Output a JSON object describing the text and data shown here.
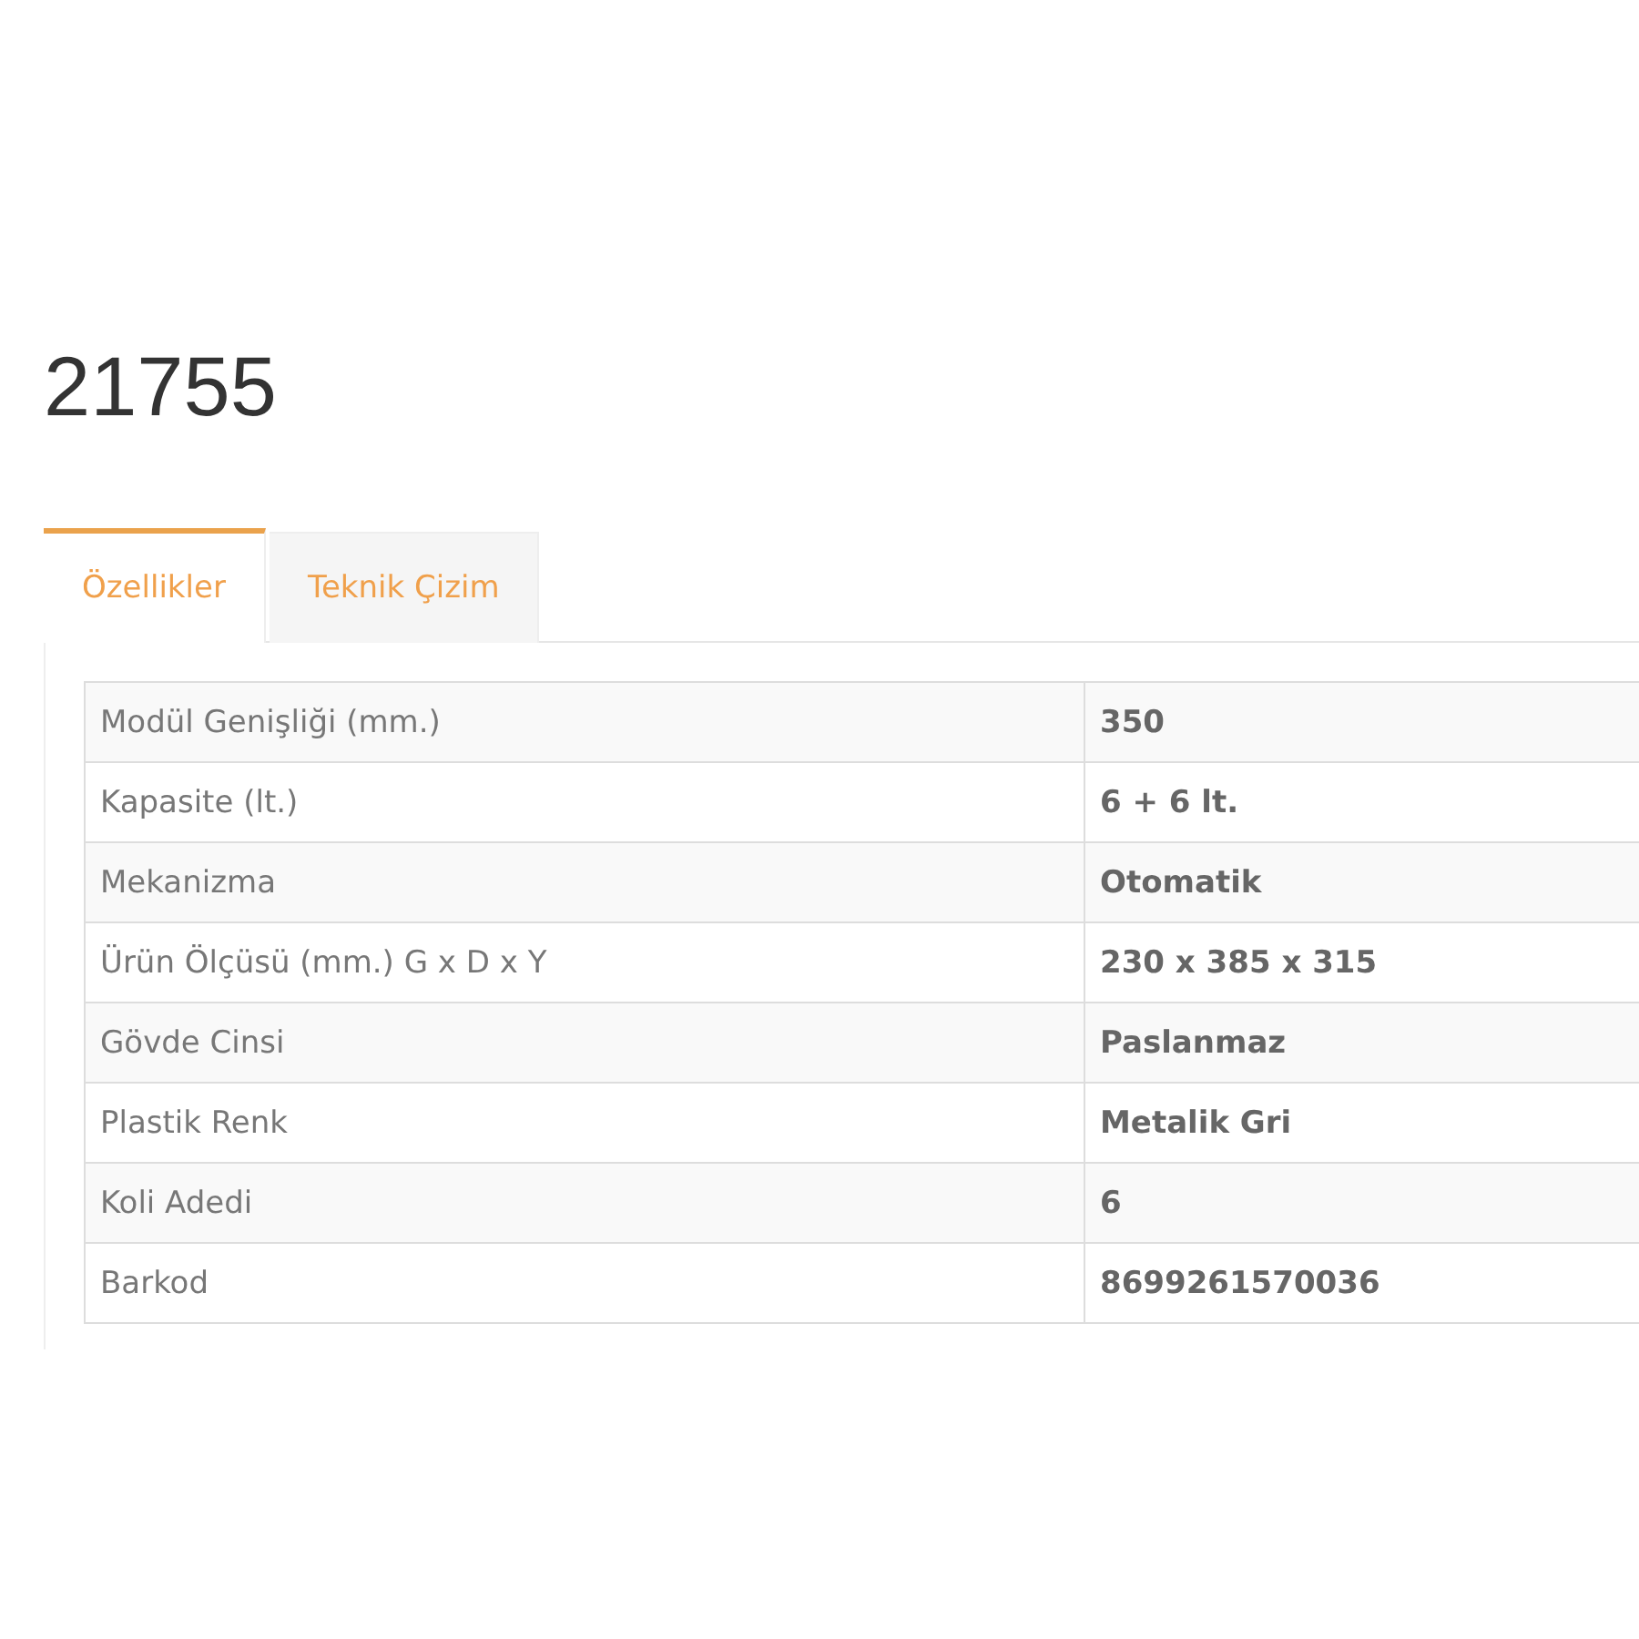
{
  "title": "21755",
  "tabs": [
    {
      "label": "Özellikler",
      "selected": true
    },
    {
      "label": "Teknik Çizim",
      "selected": false
    }
  ],
  "table": {
    "rows": [
      {
        "label": "Modül Genişliği (mm.)",
        "value": "350"
      },
      {
        "label": "Kapasite (lt.)",
        "value": "6 + 6 lt."
      },
      {
        "label": "Mekanizma",
        "value": "Otomatik"
      },
      {
        "label": "Ürün Ölçüsü (mm.) G x D x Y",
        "value": "230 x 385 x 315"
      },
      {
        "label": "Gövde Cinsi",
        "value": "Paslanmaz"
      },
      {
        "label": "Plastik Renk",
        "value": "Metalik Gri"
      },
      {
        "label": "Koli Adedi",
        "value": "6"
      },
      {
        "label": "Barkod",
        "value": "8699261570036"
      }
    ]
  }
}
